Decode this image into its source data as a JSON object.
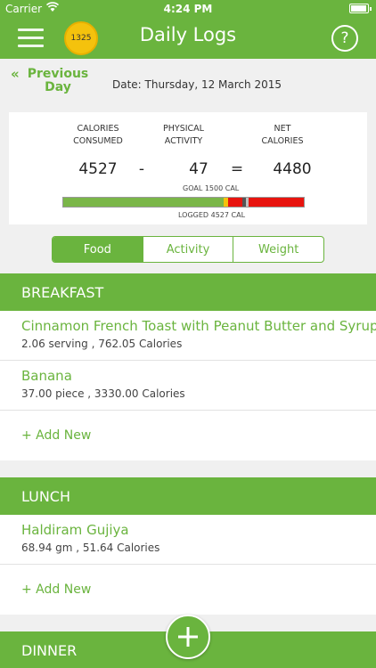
{
  "status": {
    "carrier": "Carrier",
    "time": "4:24 PM"
  },
  "navbar": {
    "badge": "1325",
    "title": "Daily Logs",
    "help": "?"
  },
  "date_row": {
    "chevron": "«",
    "prev_line1": "Previous",
    "prev_line2": "Day",
    "date": "Date: Thursday, 12 March 2015"
  },
  "summary": {
    "consumed_line1": "CALORIES",
    "consumed_line2": "CONSUMED",
    "activity_line1": "PHYSICAL",
    "activity_line2": "ACTIVITY",
    "net_line1": "NET",
    "net_line2": "CALORIES",
    "consumed": "4527",
    "minus": "-",
    "activity": "47",
    "equals": "=",
    "net": "4480",
    "goal_label": "GOAL 1500 CAL",
    "logged_label": "LOGGED 4527 CAL",
    "progress": [
      {
        "color": "#7ab648",
        "fraction": 0.665
      },
      {
        "color": "#f4c20d",
        "fraction": 0.02
      },
      {
        "color": "#e8140f",
        "fraction": 0.06
      },
      {
        "color": "#555555",
        "fraction": 0.015
      },
      {
        "color": "#bfbfbf",
        "fraction": 0.01
      },
      {
        "color": "#e8140f",
        "fraction": 0.23
      }
    ]
  },
  "tabs": [
    {
      "label": "Food",
      "active": true
    },
    {
      "label": "Activity",
      "active": false
    },
    {
      "label": "Weight",
      "active": false
    }
  ],
  "breakfast": {
    "title": "BREAKFAST",
    "items": [
      {
        "name": "Cinnamon French Toast with Peanut Butter and Syrup",
        "detail": "2.06 serving , 762.05 Calories"
      },
      {
        "name": "Banana",
        "detail": "37.00 piece , 3330.00 Calories"
      }
    ],
    "add_new": "+ Add New"
  },
  "lunch": {
    "title": "LUNCH",
    "items": [
      {
        "name": "Haldiram Gujiya",
        "detail": "68.94 gm , 51.64 Calories"
      }
    ],
    "add_new": "+ Add New"
  },
  "dinner": {
    "title": "DINNER"
  },
  "icons": {
    "menu": "menu-icon",
    "help": "help-icon",
    "back": "chevron-double-left-icon",
    "add": "plus-icon",
    "wifi": "wifi-icon",
    "battery": "battery-icon"
  },
  "colors": {
    "brand_green": "#6ab43e",
    "badge_yellow": "#f4c20d"
  }
}
